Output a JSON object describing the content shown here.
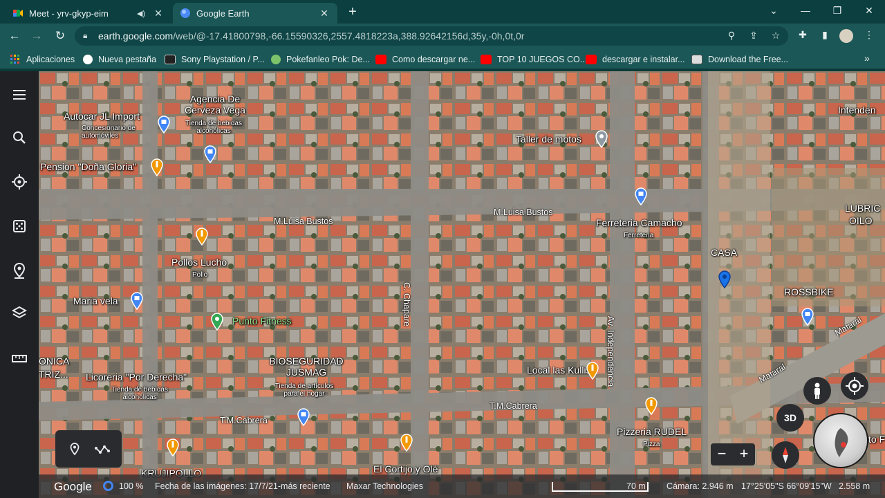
{
  "tabs": [
    {
      "title": "Meet - yrv-gkyp-eim",
      "icon": "meet-icon",
      "active": false
    },
    {
      "title": "Google Earth",
      "icon": "earth-icon",
      "active": true
    }
  ],
  "address_bar": {
    "host": "earth.google.com",
    "path": "/web/@-17.41800798,-66.15590326,2557.4818223a,388.92642156d,35y,-0h,0t,0r"
  },
  "bookmarks": [
    {
      "label": "Aplicaciones",
      "icon": "apps-grid-icon",
      "color": "#e8453c"
    },
    {
      "label": "Nueva pestaña",
      "icon": "google-icon",
      "color": "#ffffff"
    },
    {
      "label": "Sony Playstation / P...",
      "icon": "gamefaqs-icon",
      "color": "#222222"
    },
    {
      "label": "Pokefanleo Pok: De...",
      "icon": "pokeball-icon",
      "color": "#7cc36b"
    },
    {
      "label": "Como descargar ne...",
      "icon": "youtube-icon",
      "color": "#ff0000"
    },
    {
      "label": "TOP 10 JUEGOS CO...",
      "icon": "youtube-icon",
      "color": "#ff0000"
    },
    {
      "label": "descargar e instalar...",
      "icon": "youtube-icon",
      "color": "#ff0000"
    },
    {
      "label": "Download the Free...",
      "icon": "archive-icon",
      "color": "#333333"
    }
  ],
  "sidebar_icons": [
    "menu-icon",
    "search-icon",
    "voyager-icon",
    "feeling-lucky-icon",
    "projects-icon",
    "map-style-icon",
    "measure-icon"
  ],
  "map_labels": {
    "autocar": "Autocar JL Import",
    "autocar_sub": "Concesionario de automóviles",
    "agencia": "Agencia De Cerveza Vega",
    "agencia_sub": "Tienda de bebidas alcohólicas",
    "pension": "Pension \"Doña Gloria\"",
    "taller": "Taller de motos",
    "ferreteria": "Ferreteria Camacho",
    "ferreteria_sub": "Ferreteria",
    "pollos": "Pollos Lucho",
    "pollos_sub": "Pollo",
    "maria": "Maria vela",
    "punto": "Punto Fitness",
    "casa": "CASA",
    "rossbike": "ROSSBIKE",
    "bioseg": "BIOSEGURIDAD JUSMAG",
    "bioseg_sub": "Tienda de artículos para el hogar",
    "licoreria": "Licoreria \"Por Derecha\"",
    "licoreria_sub": "Tienda de bebidas alcohólicas",
    "local": "Local las Kullis",
    "pizzeria": "Pizzeria RUDEL",
    "pizzeria_sub": "Pizza",
    "cortijo": "El Cortijo y Olé",
    "krujipollo": "KRUJIPOLLO",
    "intendencia": "Intenden",
    "lubric": "LUBRIC",
    "lubric2": "OILO",
    "onica": "ONICA",
    "triz": "TRIZ...",
    "to_f": "to F"
  },
  "roads": {
    "mluisa_left": "M.Luisa Bustos",
    "mluisa_right": "M.Luisa Bustos",
    "chapare": "C. Chapare",
    "independencia": "Av. Independencia",
    "mataral1": "Mataral",
    "mataral2": "Mataral",
    "tm_cabrera_left": "T.M.Cabrera",
    "tm_cabrera_right": "T.M.Cabrera"
  },
  "controls": {
    "three_d": "3D",
    "zoom_out": "−",
    "zoom_in": "+"
  },
  "status_bar": {
    "brand": "Google",
    "percent": "100 %",
    "imagery_date": "Fecha de las imágenes: 17/7/21-más reciente",
    "provider": "Maxar Technologies",
    "scale": "70 m",
    "camera": "Cámara: 2.946 m",
    "coords": "17°25'05\"S 66°09'15\"W",
    "elevation": "2.558 m"
  }
}
